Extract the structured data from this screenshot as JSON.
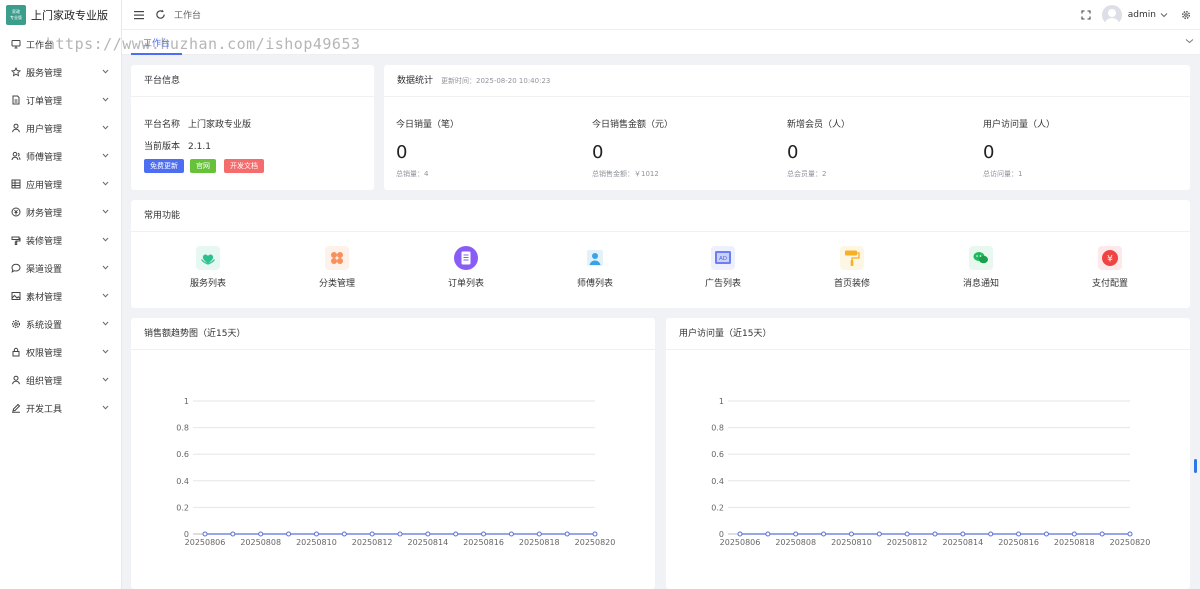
{
  "app": {
    "logo_text": "家政\n专业版",
    "title": "上门家政专业版"
  },
  "header": {
    "breadcrumb": "工作台",
    "user": "admin"
  },
  "watermark": "https://www.huzhan.com/ishop49653",
  "tabs": [
    {
      "label": "工作台"
    }
  ],
  "sidebar": {
    "items": [
      {
        "label": "工作台",
        "icon": "monitor-icon"
      },
      {
        "label": "服务管理",
        "icon": "star-icon"
      },
      {
        "label": "订单管理",
        "icon": "document-icon"
      },
      {
        "label": "用户管理",
        "icon": "user-icon"
      },
      {
        "label": "师傅管理",
        "icon": "user-group-icon"
      },
      {
        "label": "应用管理",
        "icon": "grid-icon"
      },
      {
        "label": "财务管理",
        "icon": "coin-icon"
      },
      {
        "label": "装修管理",
        "icon": "decoration-icon"
      },
      {
        "label": "渠道设置",
        "icon": "chat-icon"
      },
      {
        "label": "素材管理",
        "icon": "image-icon"
      },
      {
        "label": "系统设置",
        "icon": "gear-icon"
      },
      {
        "label": "权限管理",
        "icon": "lock-icon"
      },
      {
        "label": "组织管理",
        "icon": "user-icon"
      },
      {
        "label": "开发工具",
        "icon": "pen-icon"
      }
    ]
  },
  "platform": {
    "title": "平台信息",
    "name_label": "平台名称",
    "name_value": "上门家政专业版",
    "version_label": "当前版本",
    "version_value": "2.1.1",
    "buttons": [
      {
        "label": "免费更新",
        "color": "#4e6ef2"
      },
      {
        "label": "官网",
        "color": "#67c23a"
      },
      {
        "label": "开发文档",
        "color": "#f56c6c"
      }
    ]
  },
  "stats": {
    "title": "数据统计",
    "update_time": "更新时间：2025-08-20 10:40:23",
    "items": [
      {
        "label": "今日销量（笔）",
        "value": "0",
        "sub": "总销量：4"
      },
      {
        "label": "今日销售金额（元）",
        "value": "0",
        "sub": "总销售金额：￥1012"
      },
      {
        "label": "新增会员（人）",
        "value": "0",
        "sub": "总会员量：2"
      },
      {
        "label": "用户访问量（人）",
        "value": "0",
        "sub": "总访问量：1"
      }
    ]
  },
  "functions": {
    "title": "常用功能",
    "items": [
      {
        "label": "服务列表",
        "icon": "service-icon",
        "color": "#2bc08d"
      },
      {
        "label": "分类管理",
        "icon": "category-icon",
        "color": "#f7905c"
      },
      {
        "label": "订单列表",
        "icon": "order-icon",
        "color": "#8a5cf6"
      },
      {
        "label": "师傅列表",
        "icon": "worker-icon",
        "color": "#3aa3e8"
      },
      {
        "label": "广告列表",
        "icon": "ad-icon",
        "color": "#6b7ff0"
      },
      {
        "label": "首页装修",
        "icon": "paint-roller-icon",
        "color": "#f5b025"
      },
      {
        "label": "消息通知",
        "icon": "message-icon",
        "color": "#1fba5b"
      },
      {
        "label": "支付配置",
        "icon": "payment-icon",
        "color": "#ef4444"
      }
    ]
  },
  "chart_data": [
    {
      "type": "line",
      "title": "销售额趋势图（近15天）",
      "x": [
        "20250806",
        "20250807",
        "20250808",
        "20250809",
        "20250810",
        "20250811",
        "20250812",
        "20250813",
        "20250814",
        "20250815",
        "20250816",
        "20250817",
        "20250818",
        "20250819",
        "20250820"
      ],
      "x_tick_labels": [
        "20250806",
        "20250808",
        "20250810",
        "20250812",
        "20250814",
        "20250816",
        "20250818",
        "20250820"
      ],
      "series": [
        {
          "values": [
            0,
            0,
            0,
            0,
            0,
            0,
            0,
            0,
            0,
            0,
            0,
            0,
            0,
            0,
            0
          ]
        }
      ],
      "ylim": [
        0,
        1
      ],
      "y_ticks": [
        "0",
        "0.2",
        "0.4",
        "0.6",
        "0.8",
        "1"
      ],
      "grid": true,
      "color": "#5b6fd6"
    },
    {
      "type": "line",
      "title": "用户访问量（近15天）",
      "x": [
        "20250806",
        "20250807",
        "20250808",
        "20250809",
        "20250810",
        "20250811",
        "20250812",
        "20250813",
        "20250814",
        "20250815",
        "20250816",
        "20250817",
        "20250818",
        "20250819",
        "20250820"
      ],
      "x_tick_labels": [
        "20250806",
        "20250808",
        "20250810",
        "20250812",
        "20250814",
        "20250816",
        "20250818",
        "20250820"
      ],
      "series": [
        {
          "values": [
            0,
            0,
            0,
            0,
            0,
            0,
            0,
            0,
            0,
            0,
            0,
            0,
            0,
            0,
            0
          ]
        }
      ],
      "ylim": [
        0,
        1
      ],
      "y_ticks": [
        "0",
        "0.2",
        "0.4",
        "0.6",
        "0.8",
        "1"
      ],
      "grid": true,
      "color": "#5b6fd6"
    }
  ]
}
